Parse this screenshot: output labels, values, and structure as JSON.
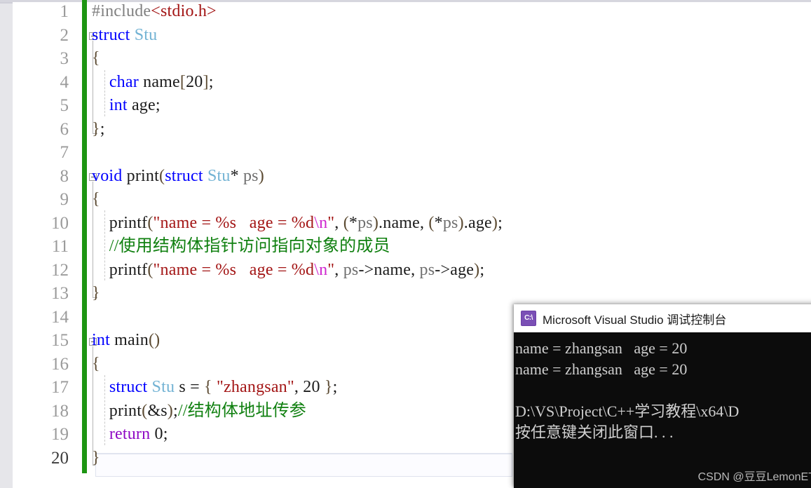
{
  "editor": {
    "name": "visual-studio-code-editor",
    "total_lines": 20,
    "current_line": 20,
    "change_bar_color": "#1d9512",
    "background": "#ffffff",
    "lines": [
      {
        "n": "1",
        "tokens": [
          {
            "t": "#include",
            "c": "t-pre"
          },
          {
            "t": "<stdio.h>",
            "c": "t-inc"
          }
        ]
      },
      {
        "n": "2",
        "tokens": [
          {
            "t": "struct",
            "c": "t-kw"
          },
          {
            "t": " ",
            "c": "t-plain"
          },
          {
            "t": "Stu",
            "c": "t-type"
          }
        ]
      },
      {
        "n": "3",
        "tokens": [
          {
            "t": "{",
            "c": "t-brk"
          }
        ]
      },
      {
        "n": "4",
        "tokens": [
          {
            "t": "    ",
            "c": "t-plain"
          },
          {
            "t": "char",
            "c": "t-kw"
          },
          {
            "t": " name",
            "c": "t-plain"
          },
          {
            "t": "[",
            "c": "t-brk"
          },
          {
            "t": "20",
            "c": "t-num"
          },
          {
            "t": "]",
            "c": "t-brk"
          },
          {
            "t": ";",
            "c": "t-plain"
          }
        ]
      },
      {
        "n": "5",
        "tokens": [
          {
            "t": "    ",
            "c": "t-plain"
          },
          {
            "t": "int",
            "c": "t-kw"
          },
          {
            "t": " age;",
            "c": "t-plain"
          }
        ]
      },
      {
        "n": "6",
        "tokens": [
          {
            "t": "}",
            "c": "t-brk"
          },
          {
            "t": ";",
            "c": "t-plain"
          }
        ]
      },
      {
        "n": "7",
        "tokens": []
      },
      {
        "n": "8",
        "tokens": [
          {
            "t": "void",
            "c": "t-kw"
          },
          {
            "t": " print",
            "c": "t-plain"
          },
          {
            "t": "(",
            "c": "t-brk"
          },
          {
            "t": "struct",
            "c": "t-kw"
          },
          {
            "t": " ",
            "c": "t-plain"
          },
          {
            "t": "Stu",
            "c": "t-type"
          },
          {
            "t": "*",
            "c": "t-plain"
          },
          {
            "t": " ",
            "c": "t-plain"
          },
          {
            "t": "ps",
            "c": "t-id"
          },
          {
            "t": ")",
            "c": "t-brk"
          }
        ]
      },
      {
        "n": "9",
        "tokens": [
          {
            "t": "{",
            "c": "t-brk"
          }
        ]
      },
      {
        "n": "10",
        "tokens": [
          {
            "t": "    printf",
            "c": "t-plain"
          },
          {
            "t": "(",
            "c": "t-brk"
          },
          {
            "t": "\"name = %s   age = %d",
            "c": "t-str"
          },
          {
            "t": "\\n",
            "c": "t-esc"
          },
          {
            "t": "\"",
            "c": "t-str"
          },
          {
            "t": ", ",
            "c": "t-plain"
          },
          {
            "t": "(",
            "c": "t-brk"
          },
          {
            "t": "*",
            "c": "t-plain"
          },
          {
            "t": "ps",
            "c": "t-id"
          },
          {
            "t": ")",
            "c": "t-brk"
          },
          {
            "t": ".name, ",
            "c": "t-plain"
          },
          {
            "t": "(",
            "c": "t-brk"
          },
          {
            "t": "*",
            "c": "t-plain"
          },
          {
            "t": "ps",
            "c": "t-id"
          },
          {
            "t": ")",
            "c": "t-brk"
          },
          {
            "t": ".age",
            "c": "t-plain"
          },
          {
            "t": ")",
            "c": "t-brk"
          },
          {
            "t": ";",
            "c": "t-plain"
          }
        ]
      },
      {
        "n": "11",
        "tokens": [
          {
            "t": "    //使用结构体指针访问指向对象的成员",
            "c": "t-cmt"
          }
        ]
      },
      {
        "n": "12",
        "tokens": [
          {
            "t": "    printf",
            "c": "t-plain"
          },
          {
            "t": "(",
            "c": "t-brk"
          },
          {
            "t": "\"name = %s   age = %d",
            "c": "t-str"
          },
          {
            "t": "\\n",
            "c": "t-esc"
          },
          {
            "t": "\"",
            "c": "t-str"
          },
          {
            "t": ", ",
            "c": "t-plain"
          },
          {
            "t": "ps",
            "c": "t-id"
          },
          {
            "t": "->name, ",
            "c": "t-plain"
          },
          {
            "t": "ps",
            "c": "t-id"
          },
          {
            "t": "->age",
            "c": "t-plain"
          },
          {
            "t": ")",
            "c": "t-brk"
          },
          {
            "t": ";",
            "c": "t-plain"
          }
        ]
      },
      {
        "n": "13",
        "tokens": [
          {
            "t": "}",
            "c": "t-brk"
          }
        ]
      },
      {
        "n": "14",
        "tokens": []
      },
      {
        "n": "15",
        "tokens": [
          {
            "t": "int",
            "c": "t-kw"
          },
          {
            "t": " main",
            "c": "t-plain"
          },
          {
            "t": "()",
            "c": "t-brk"
          }
        ]
      },
      {
        "n": "16",
        "tokens": [
          {
            "t": "{",
            "c": "t-brk"
          }
        ]
      },
      {
        "n": "17",
        "tokens": [
          {
            "t": "    ",
            "c": "t-plain"
          },
          {
            "t": "struct",
            "c": "t-kw"
          },
          {
            "t": " ",
            "c": "t-plain"
          },
          {
            "t": "Stu",
            "c": "t-type"
          },
          {
            "t": " s = ",
            "c": "t-plain"
          },
          {
            "t": "{",
            "c": "t-brk"
          },
          {
            "t": " ",
            "c": "t-plain"
          },
          {
            "t": "\"zhangsan\"",
            "c": "t-str"
          },
          {
            "t": ", ",
            "c": "t-plain"
          },
          {
            "t": "20",
            "c": "t-num"
          },
          {
            "t": " ",
            "c": "t-plain"
          },
          {
            "t": "}",
            "c": "t-brk"
          },
          {
            "t": ";",
            "c": "t-plain"
          }
        ]
      },
      {
        "n": "18",
        "tokens": [
          {
            "t": "    print",
            "c": "t-plain"
          },
          {
            "t": "(",
            "c": "t-brk"
          },
          {
            "t": "&s",
            "c": "t-plain"
          },
          {
            "t": ")",
            "c": "t-brk"
          },
          {
            "t": ";",
            "c": "t-plain"
          },
          {
            "t": "//结构体地址传参",
            "c": "t-cmt"
          }
        ]
      },
      {
        "n": "19",
        "tokens": [
          {
            "t": "    ",
            "c": "t-plain"
          },
          {
            "t": "return",
            "c": "t-ctrl"
          },
          {
            "t": " ",
            "c": "t-plain"
          },
          {
            "t": "0",
            "c": "t-num"
          },
          {
            "t": ";",
            "c": "t-plain"
          }
        ]
      },
      {
        "n": "20",
        "tokens": [
          {
            "t": "}",
            "c": "t-brk"
          }
        ]
      }
    ]
  },
  "console": {
    "title": "Microsoft Visual Studio 调试控制台",
    "icon": "cmd-icon",
    "icon_label": "C:\\",
    "background": "#0c0c0c",
    "text_color": "#cfcfcf",
    "output_lines": [
      "name = zhangsan   age = 20",
      "name = zhangsan   age = 20",
      "",
      "D:\\VS\\Project\\C++学习教程\\x64\\D",
      "按任意键关闭此窗口. . ."
    ]
  },
  "watermark": {
    "text": "CSDN @豆豆LemonET"
  }
}
